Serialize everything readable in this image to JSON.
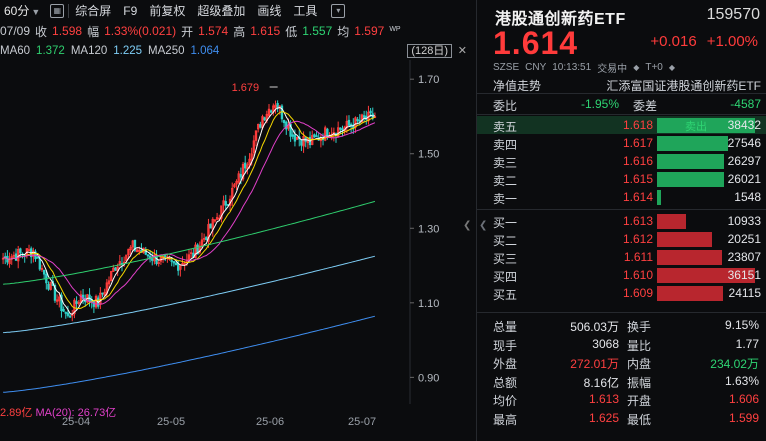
{
  "toolbar": {
    "period": "60分",
    "items": [
      "综合屏",
      "F9",
      "前复权",
      "超级叠加",
      "画线",
      "工具"
    ]
  },
  "quote_line": {
    "date": "07/09",
    "close_label": "收",
    "close": "1.598",
    "amp_label": "幅",
    "amp": "1.33%(0.021)",
    "open_label": "开",
    "open": "1.574",
    "high_label": "高",
    "high": "1.615",
    "low_label": "低",
    "low": "1.557",
    "avg_label": "均",
    "avg": "1.597"
  },
  "ma_line": {
    "ma60_label": "MA60",
    "ma60": "1.372",
    "ma120_label": "MA120",
    "ma120": "1.225",
    "ma250_label": "MA250",
    "ma250": "1.064",
    "range": "(128日)"
  },
  "chart_data": {
    "type": "candlestick",
    "y_ticks": [
      "1.70",
      "1.50",
      "1.30",
      "1.10",
      "0.90"
    ],
    "y_range": [
      0.85,
      1.73
    ],
    "x_ticks": [
      "25-04",
      "25-05",
      "25-06",
      "25-07"
    ],
    "high_annotation": "1.679",
    "volume_label_left": "2.89亿",
    "volume_label_right": "MA(20): 26.73亿",
    "ma60_last": 1.372,
    "ma120_last": 1.225,
    "ma250_last": 1.064
  },
  "quote": {
    "name": "港股通创新药ETF",
    "code": "159570",
    "price": "1.614",
    "change": "+0.016",
    "change_pct": "+1.00%",
    "market": "SZSE",
    "currency": "CNY",
    "time": "10:13:51",
    "status": "交易中",
    "settle": "T+0",
    "trend_label": "净值走势",
    "fund_name": "汇添富国证港股通创新药ETF",
    "weibi_label": "委比",
    "weibi": "-1.95%",
    "weicha_label": "委差",
    "weicha": "-4587",
    "sell_tag": "卖出"
  },
  "asks": [
    {
      "name": "卖五",
      "price": "1.618",
      "vol": "38432",
      "ratio": 1.0
    },
    {
      "name": "卖四",
      "price": "1.617",
      "vol": "27546",
      "ratio": 0.72
    },
    {
      "name": "卖三",
      "price": "1.616",
      "vol": "26297",
      "ratio": 0.68
    },
    {
      "name": "卖二",
      "price": "1.615",
      "vol": "26021",
      "ratio": 0.68
    },
    {
      "name": "卖一",
      "price": "1.614",
      "vol": "1548",
      "ratio": 0.04
    }
  ],
  "bids": [
    {
      "name": "买一",
      "price": "1.613",
      "vol": "10933",
      "ratio": 0.3
    },
    {
      "name": "买二",
      "price": "1.612",
      "vol": "20251",
      "ratio": 0.56
    },
    {
      "name": "买三",
      "price": "1.611",
      "vol": "23807",
      "ratio": 0.66
    },
    {
      "name": "买四",
      "price": "1.610",
      "vol": "36151",
      "ratio": 1.0
    },
    {
      "name": "买五",
      "price": "1.609",
      "vol": "24115",
      "ratio": 0.67
    }
  ],
  "stats": [
    {
      "l1": "总量",
      "v1": "506.03万",
      "c1": "white",
      "l2": "换手",
      "v2": "9.15%",
      "c2": "white"
    },
    {
      "l1": "现手",
      "v1": "3068",
      "c1": "white",
      "l2": "量比",
      "v2": "1.77",
      "c2": "white"
    },
    {
      "l1": "外盘",
      "v1": "272.01万",
      "c1": "red",
      "l2": "内盘",
      "v2": "234.02万",
      "c2": "green"
    },
    {
      "l1": "总额",
      "v1": "8.16亿",
      "c1": "white",
      "l2": "振幅",
      "v2": "1.63%",
      "c2": "white"
    },
    {
      "l1": "均价",
      "v1": "1.613",
      "c1": "red",
      "l2": "开盘",
      "v2": "1.606",
      "c2": "red"
    },
    {
      "l1": "最高",
      "v1": "1.625",
      "c1": "red",
      "l2": "最低",
      "v2": "1.599",
      "c2": "red"
    }
  ],
  "colors": {
    "up": "#ff3b3b",
    "down": "#2fd0c8",
    "ma5": "#ffffff",
    "ma10": "#f5d800",
    "ma20": "#e040c8",
    "ma60": "#2fce6e",
    "ma120": "#7ecdf5",
    "ma250": "#3f8ef0",
    "ask_bar": "#1fa55a",
    "bid_bar": "#b8262e"
  }
}
